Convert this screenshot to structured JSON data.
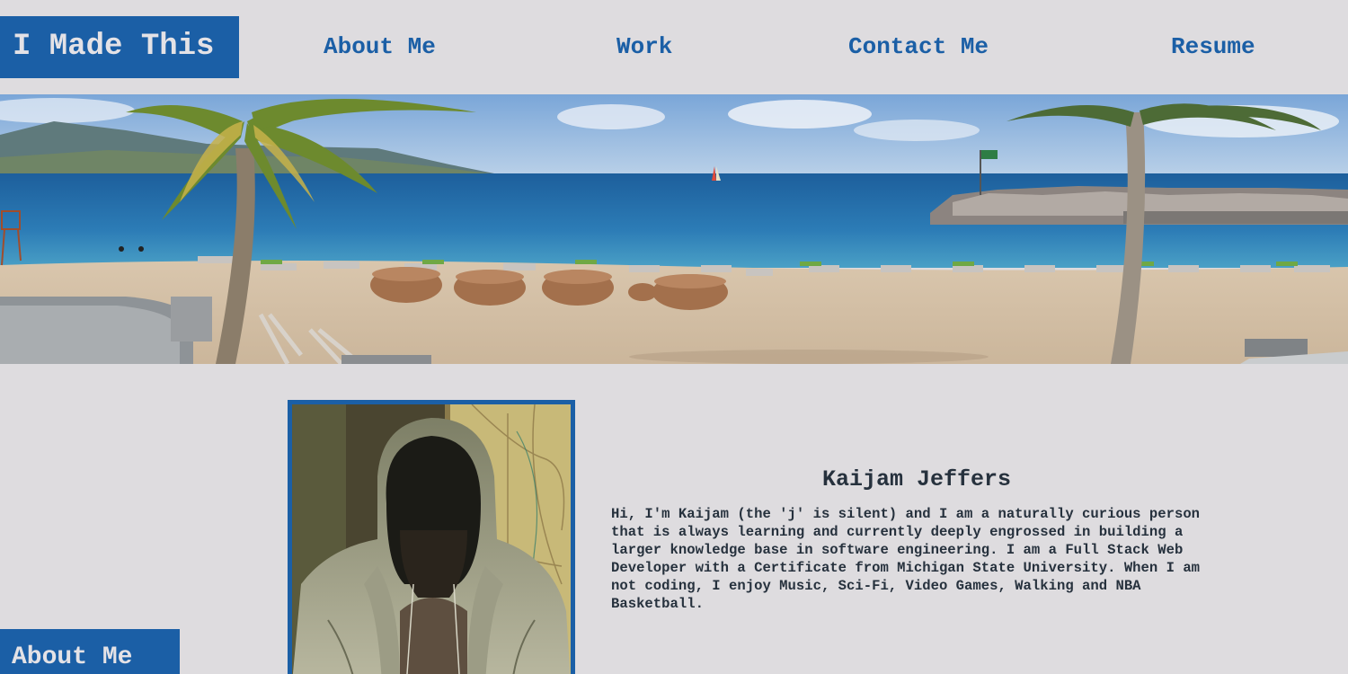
{
  "header": {
    "brand": "I Made This",
    "nav": [
      {
        "label": "About Me"
      },
      {
        "label": "Work"
      },
      {
        "label": "Contact Me"
      },
      {
        "label": "Resume"
      }
    ]
  },
  "hero": {
    "image": "beach-with-palm-trees-and-pier"
  },
  "about": {
    "section_tab": "About Me",
    "portrait": "hooded-person-photo",
    "name": "Kaijam Jeffers",
    "bio": "Hi, I'm Kaijam (the 'j' is silent) and I am a naturally curious person that is always learning and currently deeply engrossed in building a larger knowledge base in software engineering. I am a Full Stack Web Developer with a Certificate from Michigan State University. When I am not coding, I enjoy Music, Sci-Fi, Video Games, Walking and NBA Basketball."
  },
  "colors": {
    "accent": "#1b5fa6",
    "background": "#dedcdf",
    "text": "#26313d"
  }
}
